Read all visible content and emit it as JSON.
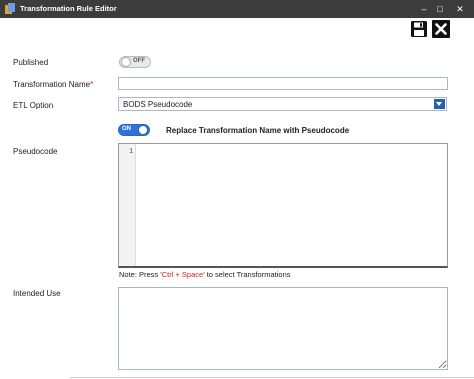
{
  "window": {
    "title": "Transformation Rule Editor",
    "controls": {
      "minimize": "–",
      "maximize": "□",
      "close": "✕"
    }
  },
  "toolbar": {
    "save_icon": "save-icon",
    "close_icon": "close-icon"
  },
  "form": {
    "published": {
      "label": "Published",
      "toggle_text": "OFF",
      "on": false
    },
    "transformation_name": {
      "label": "Transformation Name",
      "required_mark": "*",
      "value": ""
    },
    "etl_option": {
      "label": "ETL Option",
      "selected": "BODS Pseudocode"
    },
    "replace_name": {
      "toggle_text": "ON",
      "on": true,
      "label": "Replace Transformation Name with Pseudocode"
    },
    "pseudocode": {
      "label": "Pseudocode",
      "line_number": "1"
    },
    "note": {
      "prefix": "Note: Press '",
      "shortcut": "Ctrl + Space",
      "suffix": "' to select Transformations"
    },
    "intended_use": {
      "label": "Intended Use",
      "value": ""
    }
  },
  "colors": {
    "titlebar": "#3c3c3c",
    "toggle_on": "#2e74d8",
    "dropdown_arrow": "#2a5fb0",
    "required": "#d02020"
  }
}
